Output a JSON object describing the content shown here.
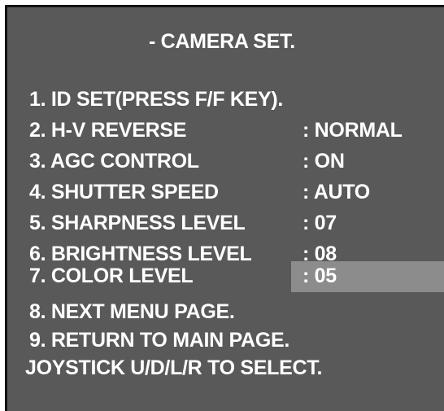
{
  "menu": {
    "title": "- CAMERA SET.",
    "items": [
      {
        "label": "1. ID SET(PRESS F/F KEY).",
        "value": ""
      },
      {
        "label": "2. H-V REVERSE",
        "value": ": NORMAL"
      },
      {
        "label": "3. AGC CONTROL",
        "value": ": ON"
      },
      {
        "label": "4. SHUTTER SPEED",
        "value": ": AUTO"
      },
      {
        "label": "5. SHARPNESS LEVEL",
        "value": ": 07"
      },
      {
        "label": "6. BRIGHTNESS LEVEL",
        "value": ": 08"
      },
      {
        "label": "7. COLOR LEVEL",
        "value": ": 05"
      },
      {
        "label": "8. NEXT MENU PAGE.",
        "value": ""
      },
      {
        "label": "9. RETURN TO MAIN PAGE.",
        "value": ""
      }
    ],
    "selected_item": 7,
    "footer_hint": "JOYSTICK U/D/L/R TO SELECT."
  },
  "colors": {
    "background": "#595959",
    "text": "#ffffff",
    "highlight": "#8c8c8c"
  }
}
